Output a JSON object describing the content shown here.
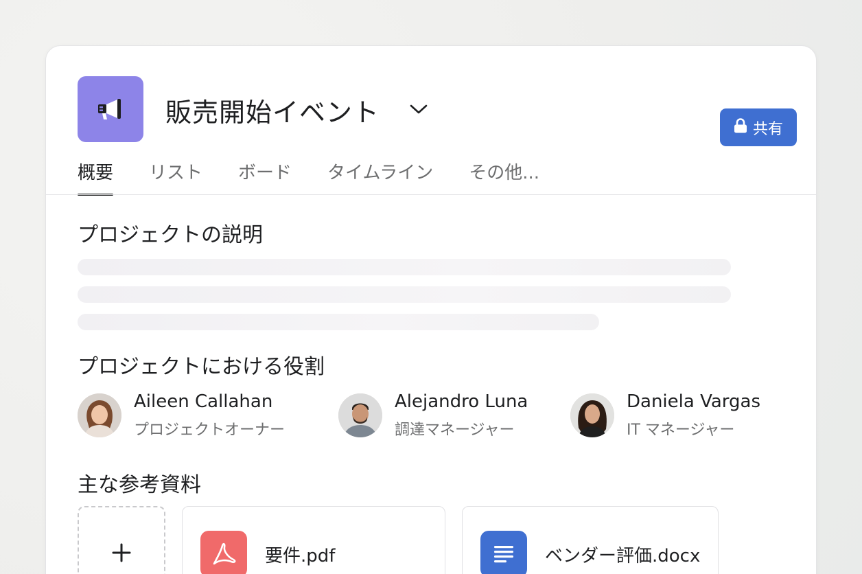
{
  "project": {
    "title": "販売開始イベント",
    "icon": "megaphone-icon",
    "icon_color": "#8d84e8"
  },
  "share_button": {
    "label": "共有",
    "icon": "lock-icon",
    "color": "#3f6fd1"
  },
  "tabs": [
    {
      "label": "概要",
      "active": true
    },
    {
      "label": "リスト",
      "active": false
    },
    {
      "label": "ボード",
      "active": false
    },
    {
      "label": "タイムライン",
      "active": false
    },
    {
      "label": "その他...",
      "active": false
    }
  ],
  "sections": {
    "description_title": "プロジェクトの説明",
    "roles_title": "プロジェクトにおける役割",
    "resources_title": "主な参考資料"
  },
  "members": [
    {
      "name": "Aileen Callahan",
      "role": "プロジェクトオーナー"
    },
    {
      "name": "Alejandro Luna",
      "role": "調達マネージャー"
    },
    {
      "name": "Daniela Vargas",
      "role": "IT マネージャー"
    }
  ],
  "resources": {
    "add_icon": "plus-icon",
    "files": [
      {
        "name": "要件.pdf",
        "icon": "pdf-icon",
        "color": "#f06a6a"
      },
      {
        "name": "ベンダー評価.docx",
        "icon": "document-icon",
        "color": "#3f6fd1"
      }
    ]
  }
}
